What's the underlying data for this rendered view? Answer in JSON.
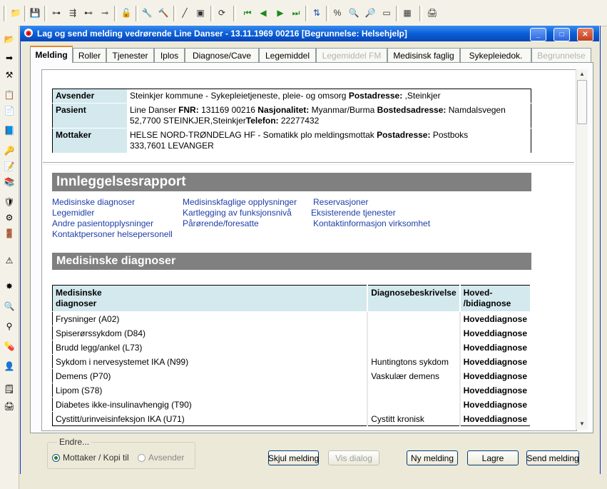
{
  "window": {
    "title": "Lag og send melding vedrørende Line Danser  -  13.11.1969  00216  [Begrunnelse: Helsehjelp]",
    "minimize": "_",
    "maximize": "□",
    "close": "✕"
  },
  "tabs": [
    {
      "label": "Melding",
      "active": true
    },
    {
      "label": "Roller"
    },
    {
      "label": "Tjenester"
    },
    {
      "label": "Iplos"
    },
    {
      "label": "Diagnose/Cave"
    },
    {
      "label": "Legemiddel"
    },
    {
      "label": "Legemiddel FM",
      "disabled": true
    },
    {
      "label": "Medisinsk faglig"
    },
    {
      "label": "Sykepleiedok."
    },
    {
      "label": "Begrunnelse",
      "disabled": true
    }
  ],
  "header": {
    "avsender": {
      "label": "Avsender",
      "name": "Steinkjer kommune - Sykepleietjeneste, pleie- og omsorg",
      "postadresse_label": "Postadresse:",
      "postadresse": ",Steinkjer"
    },
    "pasient": {
      "label": "Pasient",
      "name": "Line  Danser",
      "fnr_label": "FNR:",
      "fnr": "131169 00216",
      "nasj_label": "Nasjonalitet:",
      "nasj": "Myanmar/Burma",
      "bosted_label": "Bostedsadresse:",
      "bosted": "Namdalsvegen",
      "bosted2": "52,7700 STEINKJER,Steinkjer",
      "telefon_label": "Telefon:",
      "telefon": "22277432"
    },
    "mottaker": {
      "label": "Mottaker",
      "name": "HELSE NORD-TRØNDELAG HF - Somatikk plo meldingsmottak",
      "postadresse_label": "Postadresse:",
      "postadresse": "Postboks",
      "postadresse2": "333,7601 LEVANGER"
    }
  },
  "report": {
    "title": "Innleggelsesrapport",
    "links": {
      "medisinske_diagnoser": "Medisinske diagnoser",
      "medisinskfaglige": "Medisinskfaglige opplysninger",
      "reservasjoner": "Reservasjoner",
      "legemidler": "Legemidler",
      "kartlegging": "Kartlegging av funksjonsnivå",
      "eksisterende": "Eksisterende tjenester",
      "andre": "Andre pasientopplysninger",
      "parorende": "Pårørende/foresatte",
      "kontaktinfo": "Kontaktinformasjon virksomhet",
      "kontaktpersoner": "Kontaktpersoner helsepersonell"
    }
  },
  "diagnoses": {
    "section_title": "Medisinske diagnoser",
    "col1_line1": "Medisinske",
    "col1_line2": "diagnoser",
    "col2": "Diagnosebeskrivelse",
    "col3_line1": "Hoved-",
    "col3_line2": "/bidiagnose",
    "rows": [
      {
        "diagnose": "Frysninger (A02)",
        "beskrivelse": "",
        "type": "Hoveddiagnose"
      },
      {
        "diagnose": "Spiserørssykdom (D84)",
        "beskrivelse": "",
        "type": "Hoveddiagnose"
      },
      {
        "diagnose": "Brudd legg/ankel (L73)",
        "beskrivelse": "",
        "type": "Hoveddiagnose"
      },
      {
        "diagnose": "Sykdom i nervesystemet IKA (N99)",
        "beskrivelse": "Huntingtons sykdom",
        "type": "Hoveddiagnose"
      },
      {
        "diagnose": "Demens (P70)",
        "beskrivelse": "Vaskulær demens",
        "type": "Hoveddiagnose"
      },
      {
        "diagnose": "Lipom (S78)",
        "beskrivelse": "",
        "type": "Hoveddiagnose"
      },
      {
        "diagnose": "Diabetes ikke-insulinavhengig (T90)",
        "beskrivelse": "",
        "type": "Hoveddiagnose"
      },
      {
        "diagnose": "Cystitt/urinveisinfeksjon IKA (U71)",
        "beskrivelse": "Cystitt kronisk",
        "type": "Hoveddiagnose"
      }
    ]
  },
  "bottom": {
    "endre_label": "Endre...",
    "radio_mottaker": "Mottaker / Kopi til",
    "radio_avsender": "Avsender",
    "skjul": "Skjul melding",
    "vis_dialog": "Vis dialog",
    "ny": "Ny melding",
    "lagre": "Lagre",
    "send": "Send melding"
  }
}
